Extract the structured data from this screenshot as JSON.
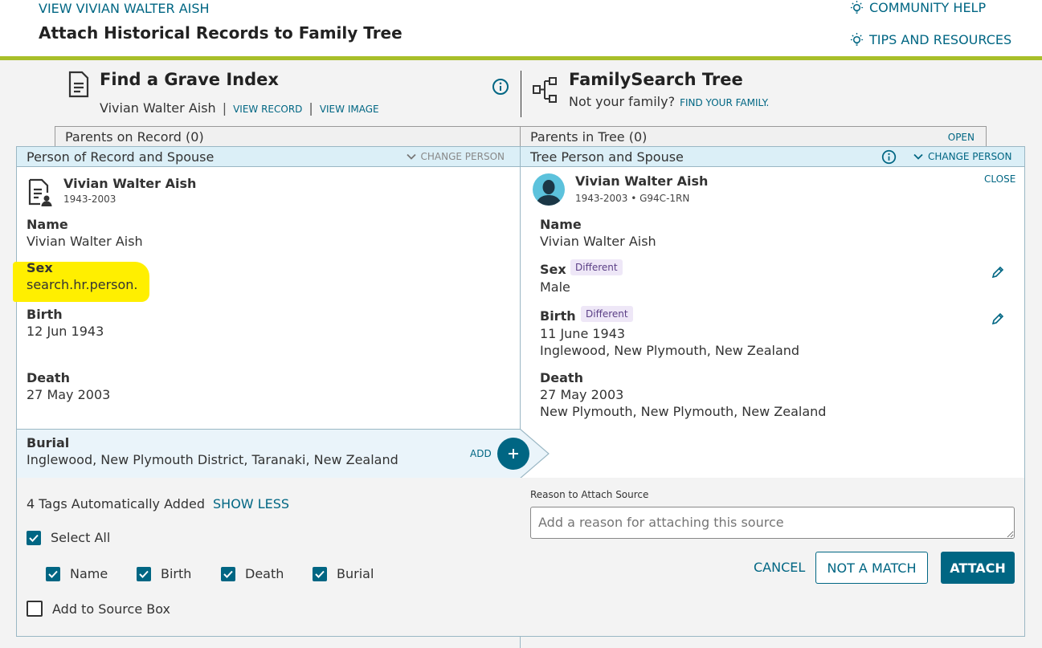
{
  "header": {
    "view_person_link": "VIEW VIVIAN WALTER AISH",
    "page_title": "Attach Historical Records to Family Tree",
    "community_help": "COMMUNITY HELP",
    "tips_resources": "TIPS AND RESOURCES"
  },
  "record": {
    "collection_title": "Find a Grave Index",
    "person_name": "Vivian Walter Aish",
    "view_record": "VIEW RECORD",
    "view_image": "VIEW IMAGE",
    "separator": "|"
  },
  "tree": {
    "title": "FamilySearch Tree",
    "not_your_family": "Not your family?",
    "find_your_family": "FIND YOUR FAMILY."
  },
  "left": {
    "parents_tab": "Parents on Record (0)",
    "section_title": "Person of Record and Spouse",
    "change_person": "CHANGE PERSON",
    "person_name": "Vivian Walter Aish",
    "person_dates": "1943-2003",
    "name_label": "Name",
    "name_value": "Vivian Walter Aish",
    "sex_label": "Sex",
    "sex_value": "search.hr.person.",
    "birth_label": "Birth",
    "birth_value": "12 Jun 1943",
    "death_label": "Death",
    "death_value": "27 May 2003",
    "burial_label": "Burial",
    "burial_value": "Inglewood, New Plymouth District, Taranaki, New Zealand",
    "add_label": "ADD",
    "highlight_color": "#ffef00"
  },
  "right": {
    "parents_tab": "Parents in Tree (0)",
    "open": "OPEN",
    "section_title": "Tree Person and Spouse",
    "change_person": "CHANGE PERSON",
    "close": "CLOSE",
    "person_name": "Vivian Walter Aish",
    "person_dates_id": "1943-2003 • G94C-1RN",
    "name_label": "Name",
    "name_value": "Vivian Walter Aish",
    "sex_label": "Sex",
    "sex_tag": "Different",
    "sex_value": "Male",
    "birth_label": "Birth",
    "birth_tag": "Different",
    "birth_date": "11 June 1943",
    "birth_place": "Inglewood, New Plymouth, New Zealand",
    "death_label": "Death",
    "death_date": "27 May 2003",
    "death_place": "New Plymouth, New Plymouth, New Zealand"
  },
  "tags": {
    "summary": "4 Tags Automatically Added",
    "show_less": "SHOW LESS",
    "select_all": "Select All",
    "items": [
      "Name",
      "Birth",
      "Death",
      "Burial"
    ],
    "add_to_source_box": "Add to Source Box"
  },
  "reason": {
    "label": "Reason to Attach Source",
    "placeholder": "Add a reason for attaching this source"
  },
  "actions": {
    "cancel": "CANCEL",
    "not_a_match": "NOT A MATCH",
    "attach": "ATTACH"
  },
  "colors": {
    "accent": "#006683",
    "header_rule": "#a8bf29",
    "section_bar": "#dbeff7",
    "diff_tag_bg": "#eee7f7"
  }
}
